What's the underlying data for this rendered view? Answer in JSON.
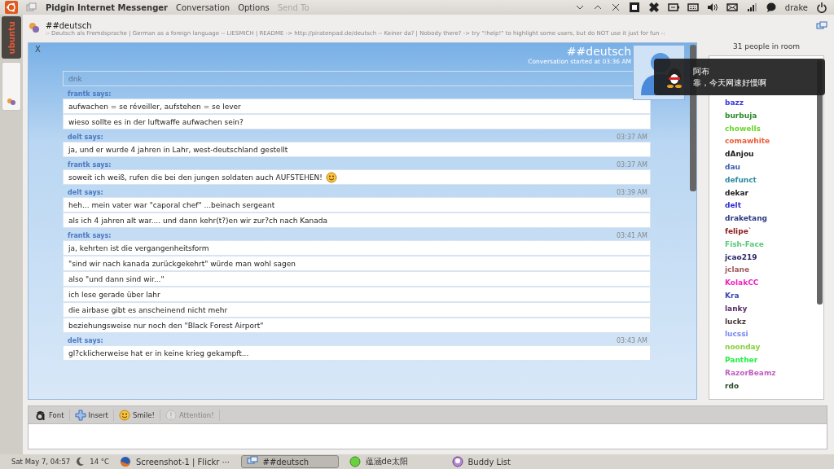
{
  "top_panel": {
    "app_title": "Pidgin Internet Messenger",
    "menus": [
      {
        "label": "Conversation",
        "disabled": false
      },
      {
        "label": "Options",
        "disabled": false
      },
      {
        "label": "Send To",
        "disabled": true
      }
    ],
    "user": "drake"
  },
  "launcher": {
    "label": "ubuntu"
  },
  "conversation": {
    "title": "##deutsch",
    "topic": ":- Deutsch als Fremdsprache | German as a foreign language -- LIESMICH | README -> http://piratenpad.de/deutsch -- Keiner da? | Nobody there? -> try \"!help!\" to highlight some users, but do NOT use it just for fun -:"
  },
  "chat": {
    "close": "X",
    "title": "##deutsch",
    "started": "Conversation started at 03:36 AM",
    "messages": [
      {
        "faded": true,
        "lines": [
          {
            "text": "dnk"
          }
        ]
      },
      {
        "sender": "frantk says:",
        "faded": false,
        "lines": [
          {
            "text": "aufwachen = se réveiller, aufstehen = se lever"
          },
          {
            "text": "wieso sollte es in der luftwaffe aufwachen sein?"
          }
        ]
      },
      {
        "sender": "delt says:",
        "time": "03:37 AM",
        "faded": false,
        "lines": [
          {
            "text": "ja, und er wurde 4 jahren in Lahr, west-deutschland gestellt"
          }
        ]
      },
      {
        "sender": "frantk says:",
        "time": "03:37 AM",
        "faded": false,
        "lines": [
          {
            "text": "soweit ich weiß, rufen die bei den jungen soldaten auch AUFSTEHEN!",
            "smiley": true
          }
        ]
      },
      {
        "sender": "delt says:",
        "time": "03:39 AM",
        "faded": false,
        "lines": [
          {
            "text": "heh... mein vater war \"caporal chef\" ...beinach sergeant"
          },
          {
            "text": "als ich 4 jahren alt war.... und dann kehr(t?)en wir zur?ch nach Kanada"
          }
        ]
      },
      {
        "sender": "frantk says:",
        "time": "03:41 AM",
        "faded": false,
        "lines": [
          {
            "text": "ja, kehrten ist die vergangenheitsform"
          },
          {
            "text": "\"sind wir nach kanada zurückgekehrt\" würde man wohl sagen"
          },
          {
            "text": "also \"und dann sind wir...\""
          },
          {
            "text": "ich lese gerade über lahr"
          },
          {
            "text": "die airbase gibt es anscheinend nicht mehr"
          },
          {
            "text": "beziehungsweise nur noch den \"Black Forest Airport\""
          }
        ]
      },
      {
        "sender": "delt says:",
        "time": "03:43 AM",
        "faded": false,
        "lines": [
          {
            "text": "gl?cklicherweise hat er in keine krieg gekampft..."
          }
        ]
      }
    ]
  },
  "room": {
    "count": "31 people in room",
    "users": [
      {
        "name": "bazz",
        "color": "#3a3ad8"
      },
      {
        "name": "burbuja",
        "color": "#2e8b2e"
      },
      {
        "name": "chowells",
        "color": "#6ad62a"
      },
      {
        "name": "comawhite",
        "color": "#e8603a"
      },
      {
        "name": "dAnjou",
        "color": "#202020"
      },
      {
        "name": "dau",
        "color": "#3a5fb0"
      },
      {
        "name": "defunct",
        "color": "#2a8aa0"
      },
      {
        "name": "dekar",
        "color": "#222222"
      },
      {
        "name": "delt",
        "color": "#2a2ad0"
      },
      {
        "name": "draketang",
        "color": "#2a3a80"
      },
      {
        "name": "felipe`",
        "color": "#8a1a1a"
      },
      {
        "name": "Fish-Face",
        "color": "#5ac87a"
      },
      {
        "name": "jcao219",
        "color": "#2a2a6a"
      },
      {
        "name": "jclane",
        "color": "#a05a5a"
      },
      {
        "name": "KolakCC",
        "color": "#f020c0"
      },
      {
        "name": "Kra",
        "color": "#3a4ab0"
      },
      {
        "name": "lanky",
        "color": "#5a2a6a"
      },
      {
        "name": "luckz",
        "color": "#4a3a3a"
      },
      {
        "name": "lucssi",
        "color": "#7a8af0"
      },
      {
        "name": "noonday",
        "color": "#8ad040"
      },
      {
        "name": "Panther",
        "color": "#20f040"
      },
      {
        "name": "RazorBeamz",
        "color": "#c060c0"
      },
      {
        "name": "rdo",
        "color": "#2a4a2a"
      }
    ]
  },
  "toolbar": [
    {
      "label": "Font",
      "disabled": false
    },
    {
      "label": "Insert",
      "disabled": false
    },
    {
      "label": "Smile!",
      "disabled": false
    },
    {
      "label": "Attention!",
      "disabled": true
    }
  ],
  "notification": {
    "title": "阿布",
    "body": "靠，今天网速好慢啊"
  },
  "bottom_panel": {
    "clock": "Sat May  7, 04:57",
    "weather": "14 °C",
    "tasks": [
      {
        "label": "Screenshot-1 | Flickr ⋯",
        "selected": false
      },
      {
        "label": "##deutsch",
        "selected": true
      },
      {
        "label": "蕴涵de太阳",
        "selected": false
      },
      {
        "label": "Buddy List",
        "selected": false
      }
    ]
  }
}
